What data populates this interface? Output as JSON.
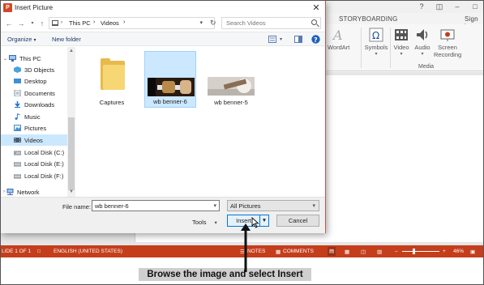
{
  "ppt": {
    "ribbon_tab_storyboarding": "STORYBOARDING",
    "sign_in": "Sign in",
    "wordart_label": "WordArt",
    "symbols_label": "Symbols",
    "video_label": "Video",
    "audio_label": "Audio",
    "screen_recording_label": "Screen Recording",
    "media_group_label": "Media",
    "status_slide": "LIDE 1 OF 1",
    "status_language": "ENGLISH (UNITED STATES)",
    "status_notes": "NOTES",
    "status_comments": "COMMENTS",
    "status_zoom": "46%",
    "colors": {
      "accent": "#c43e1c"
    }
  },
  "dialog": {
    "title": "Insert Picture",
    "breadcrumb": [
      "This PC",
      "Videos"
    ],
    "search_placeholder": "Search Videos",
    "organize_label": "Organize",
    "new_folder_label": "New folder",
    "nav_items": [
      {
        "label": "This PC",
        "icon": "computer-icon",
        "selected": false
      },
      {
        "label": "3D Objects",
        "icon": "3d-objects-icon",
        "selected": false
      },
      {
        "label": "Desktop",
        "icon": "desktop-icon",
        "selected": false
      },
      {
        "label": "Documents",
        "icon": "documents-icon",
        "selected": false
      },
      {
        "label": "Downloads",
        "icon": "downloads-icon",
        "selected": false
      },
      {
        "label": "Music",
        "icon": "music-icon",
        "selected": false
      },
      {
        "label": "Pictures",
        "icon": "pictures-icon",
        "selected": false
      },
      {
        "label": "Videos",
        "icon": "videos-icon",
        "selected": true
      },
      {
        "label": "Local Disk (C:)",
        "icon": "disk-icon",
        "selected": false
      },
      {
        "label": "Local Disk (E:)",
        "icon": "disk-icon",
        "selected": false
      },
      {
        "label": "Local Disk (F:)",
        "icon": "disk-icon",
        "selected": false
      },
      {
        "label": "Network",
        "icon": "network-icon",
        "selected": false
      }
    ],
    "files": [
      {
        "name": "Captures",
        "type": "folder",
        "selected": false
      },
      {
        "name": "wb benner-6",
        "type": "image",
        "selected": true
      },
      {
        "name": "wb benner-5",
        "type": "image",
        "selected": false
      }
    ],
    "file_name_label": "File name:",
    "file_name_value": "wb benner-6",
    "file_type_value": "All Pictures",
    "tools_label": "Tools",
    "insert_label": "Insert",
    "cancel_label": "Cancel"
  },
  "caption": "Browse the image and select Insert"
}
